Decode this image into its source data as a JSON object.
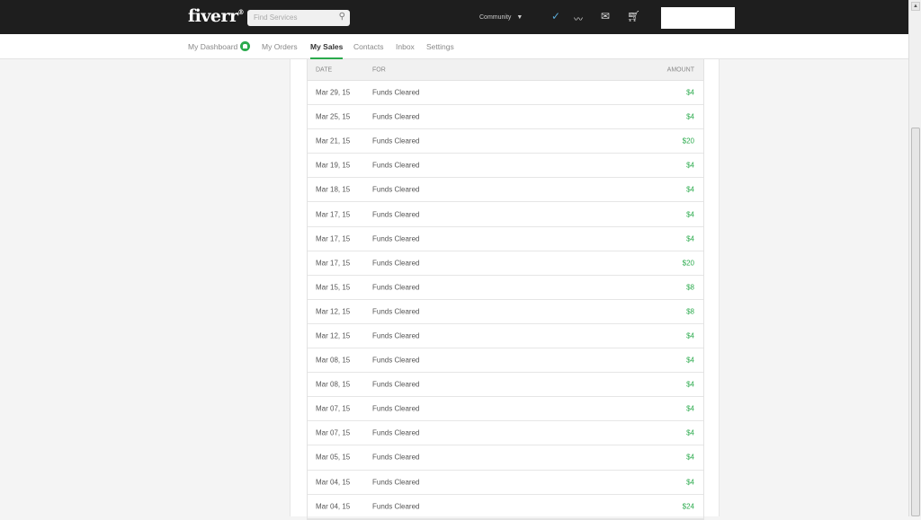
{
  "header": {
    "logo": "fiverr",
    "search_placeholder": "Find Services",
    "community": "Community",
    "caret": "▼"
  },
  "nav": [
    {
      "label": "My Dashboard"
    },
    {
      "label": "My Orders"
    },
    {
      "label": "My Sales"
    },
    {
      "label": "Contacts"
    },
    {
      "label": "Inbox"
    },
    {
      "label": "Settings"
    }
  ],
  "table": {
    "headers": {
      "date": "DATE",
      "for": "FOR",
      "amount": "AMOUNT"
    },
    "rows": [
      {
        "date": "Mar 29, 15",
        "for": "Funds Cleared",
        "amount": "$4"
      },
      {
        "date": "Mar 25, 15",
        "for": "Funds Cleared",
        "amount": "$4"
      },
      {
        "date": "Mar 21, 15",
        "for": "Funds Cleared",
        "amount": "$20"
      },
      {
        "date": "Mar 19, 15",
        "for": "Funds Cleared",
        "amount": "$4"
      },
      {
        "date": "Mar 18, 15",
        "for": "Funds Cleared",
        "amount": "$4"
      },
      {
        "date": "Mar 17, 15",
        "for": "Funds Cleared",
        "amount": "$4"
      },
      {
        "date": "Mar 17, 15",
        "for": "Funds Cleared",
        "amount": "$4"
      },
      {
        "date": "Mar 17, 15",
        "for": "Funds Cleared",
        "amount": "$20"
      },
      {
        "date": "Mar 15, 15",
        "for": "Funds Cleared",
        "amount": "$8"
      },
      {
        "date": "Mar 12, 15",
        "for": "Funds Cleared",
        "amount": "$8"
      },
      {
        "date": "Mar 12, 15",
        "for": "Funds Cleared",
        "amount": "$4"
      },
      {
        "date": "Mar 08, 15",
        "for": "Funds Cleared",
        "amount": "$4"
      },
      {
        "date": "Mar 08, 15",
        "for": "Funds Cleared",
        "amount": "$4"
      },
      {
        "date": "Mar 07, 15",
        "for": "Funds Cleared",
        "amount": "$4"
      },
      {
        "date": "Mar 07, 15",
        "for": "Funds Cleared",
        "amount": "$4"
      },
      {
        "date": "Mar 05, 15",
        "for": "Funds Cleared",
        "amount": "$4"
      },
      {
        "date": "Mar 04, 15",
        "for": "Funds Cleared",
        "amount": "$4"
      },
      {
        "date": "Mar 04, 15",
        "for": "Funds Cleared",
        "amount": "$24"
      }
    ]
  },
  "colors": {
    "accent": "#2aaa4c",
    "topbar": "#1e1e1e"
  }
}
